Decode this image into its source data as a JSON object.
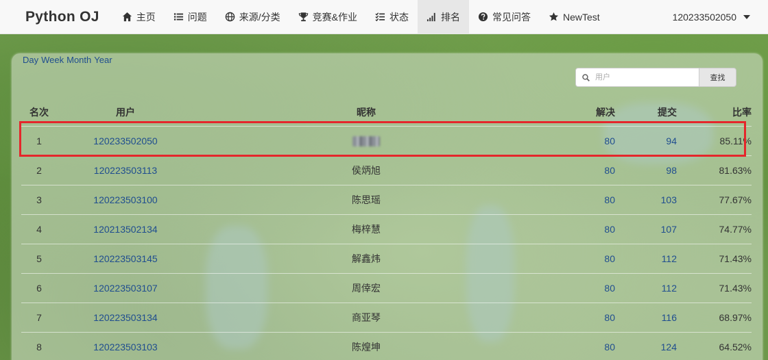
{
  "navbar": {
    "brand": "Python OJ",
    "items": [
      {
        "label": "主页",
        "icon": "home-icon"
      },
      {
        "label": "问题",
        "icon": "list-icon"
      },
      {
        "label": "来源/分类",
        "icon": "globe-icon"
      },
      {
        "label": "竞赛&作业",
        "icon": "trophy-icon"
      },
      {
        "label": "状态",
        "icon": "checklist-icon"
      },
      {
        "label": "排名",
        "icon": "signal-icon",
        "active": true
      },
      {
        "label": "常见问答",
        "icon": "question-circle-icon"
      },
      {
        "label": "NewTest",
        "icon": "star-icon"
      }
    ],
    "user": "120233502050"
  },
  "periods": [
    "Day",
    "Week",
    "Month",
    "Year"
  ],
  "search": {
    "placeholder": "用户",
    "button": "查找"
  },
  "table": {
    "headers": {
      "rank": "名次",
      "user": "用户",
      "nickname": "昵称",
      "solved": "解决",
      "submitted": "提交",
      "ratio": "比率"
    },
    "rows": [
      {
        "rank": "1",
        "user": "120233502050",
        "nickname": "",
        "solved": "80",
        "submitted": "94",
        "ratio": "85.11%"
      },
      {
        "rank": "2",
        "user": "120223503113",
        "nickname": "侯炳旭",
        "solved": "80",
        "submitted": "98",
        "ratio": "81.63%"
      },
      {
        "rank": "3",
        "user": "120223503100",
        "nickname": "陈思瑶",
        "solved": "80",
        "submitted": "103",
        "ratio": "77.67%"
      },
      {
        "rank": "4",
        "user": "120213502134",
        "nickname": "梅梓慧",
        "solved": "80",
        "submitted": "107",
        "ratio": "74.77%"
      },
      {
        "rank": "5",
        "user": "120223503145",
        "nickname": "解鑫炜",
        "solved": "80",
        "submitted": "112",
        "ratio": "71.43%"
      },
      {
        "rank": "6",
        "user": "120223503107",
        "nickname": "周倖宏",
        "solved": "80",
        "submitted": "112",
        "ratio": "71.43%"
      },
      {
        "rank": "7",
        "user": "120223503134",
        "nickname": "商亚琴",
        "solved": "80",
        "submitted": "116",
        "ratio": "68.97%"
      },
      {
        "rank": "8",
        "user": "120223503103",
        "nickname": "陈煌坤",
        "solved": "80",
        "submitted": "124",
        "ratio": "64.52%"
      }
    ]
  },
  "colors": {
    "link": "#1f4d8f",
    "highlight": "#e5262b",
    "navbar": "#f8f8f8"
  }
}
